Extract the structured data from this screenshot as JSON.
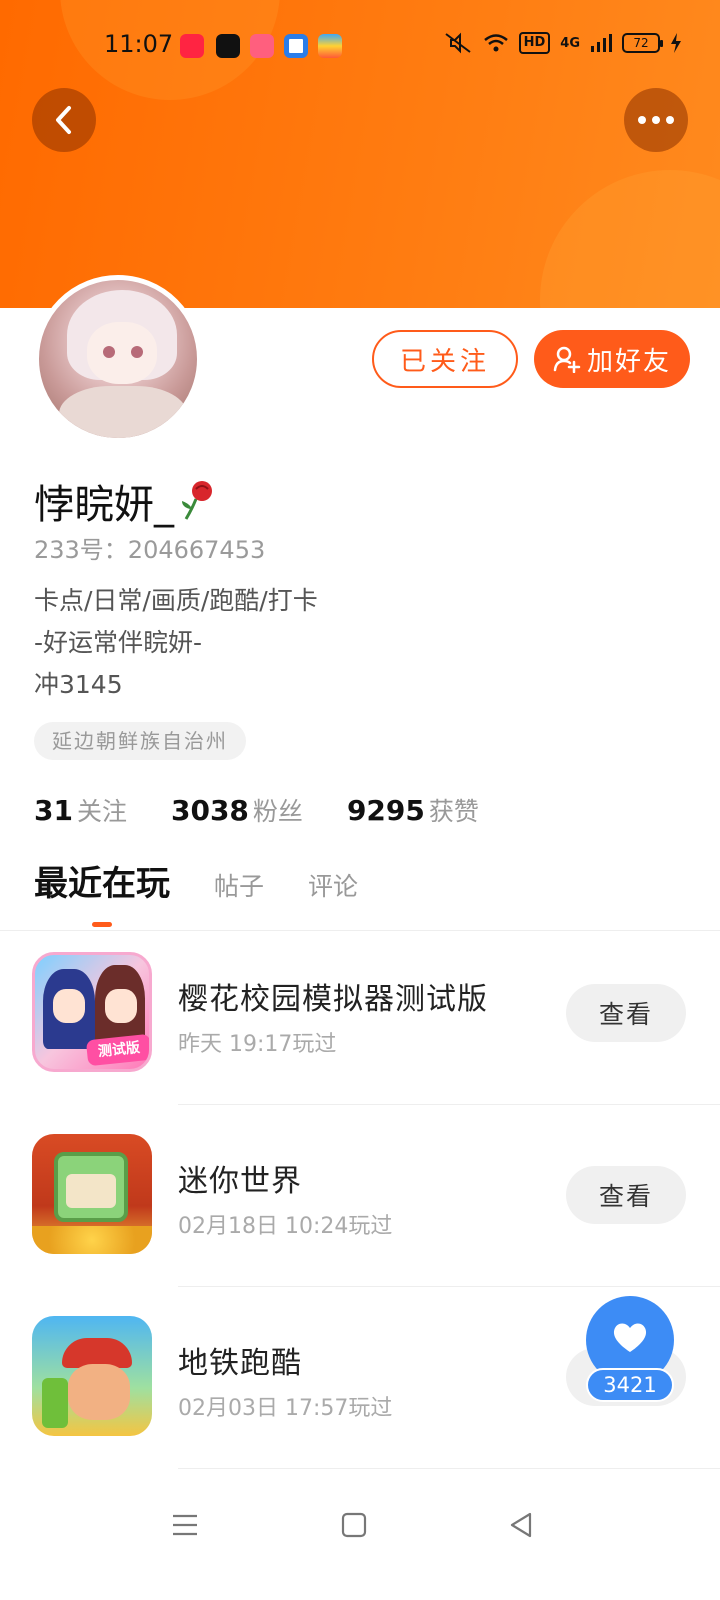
{
  "status_bar": {
    "time": "11:07",
    "battery": "72",
    "hd": "HD",
    "network": "4G",
    "app_icons": [
      "xiaohongshu-icon",
      "app-icon",
      "music-icon",
      "browser-icon",
      "wallet-icon"
    ]
  },
  "colors": {
    "accent": "#ff5b1a",
    "header_gradient_start": "#ff6a00",
    "header_gradient_end": "#ff8a1e",
    "like_blue": "#3d8cf5"
  },
  "profile": {
    "username": "悖睆妍_",
    "user_id": "233号：204667453",
    "bio": [
      "卡点/日常/画质/跑酷/打卡",
      "-好运常伴睆妍-",
      "冲3145"
    ],
    "location": "延边朝鲜族自治州",
    "follow_label": "已关注",
    "add_friend_label": "加好友"
  },
  "stats": [
    {
      "value": "31",
      "label": "关注"
    },
    {
      "value": "3038",
      "label": "粉丝"
    },
    {
      "value": "9295",
      "label": "获赞"
    }
  ],
  "tabs": [
    {
      "label": "最近在玩",
      "active": true
    },
    {
      "label": "帖子",
      "active": false
    },
    {
      "label": "评论",
      "active": false
    }
  ],
  "games": [
    {
      "title": "樱花校园模拟器测试版",
      "time": "昨天 19:17玩过",
      "button": "查看",
      "icon_tag": "测试版"
    },
    {
      "title": "迷你世界",
      "time": "02月18日 10:24玩过",
      "button": "查看"
    },
    {
      "title": "地铁跑酷",
      "time": "02月03日 17:57玩过",
      "button": "查看"
    }
  ],
  "like_fab": {
    "count": "3421"
  }
}
